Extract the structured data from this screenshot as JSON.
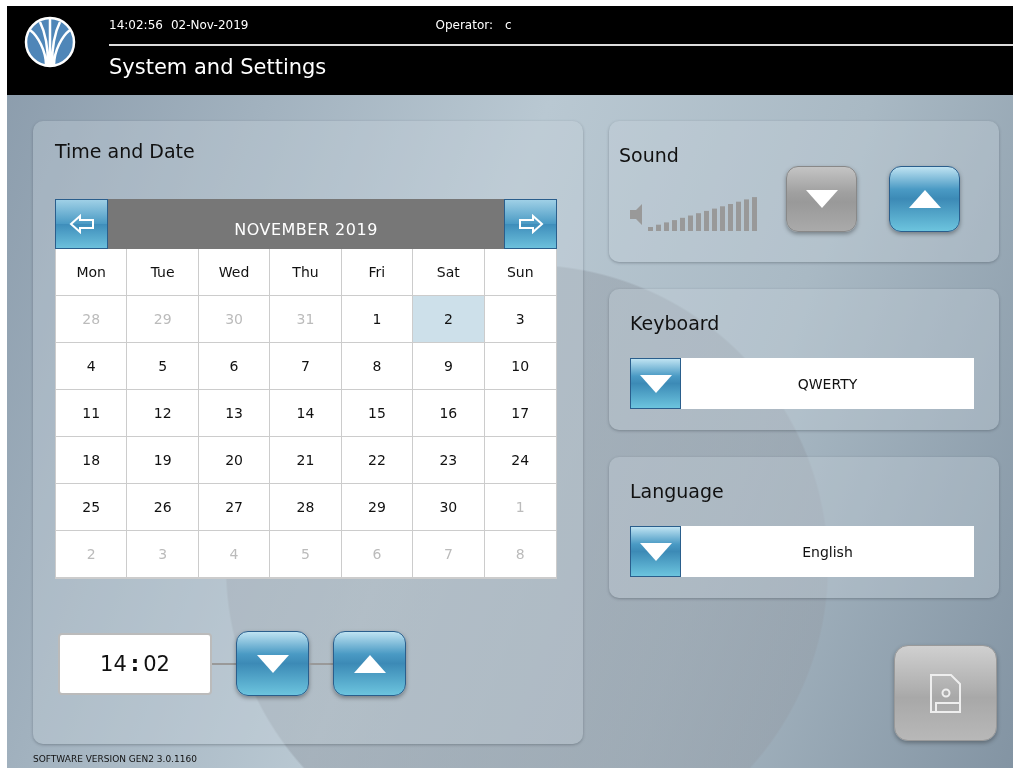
{
  "header": {
    "time": "14:02:56",
    "date": "02-Nov-2019",
    "operator_label": "Operator:",
    "operator": "c",
    "title": "System and Settings"
  },
  "time_and_date": {
    "title": "Time and Date",
    "month": "NOVEMBER 2019",
    "weekdays": [
      "Mon",
      "Tue",
      "Wed",
      "Thu",
      "Fri",
      "Sat",
      "Sun"
    ],
    "weeks": [
      [
        {
          "day": "28",
          "other_month": true,
          "selected": false
        },
        {
          "day": "29",
          "other_month": true,
          "selected": false
        },
        {
          "day": "30",
          "other_month": true,
          "selected": false
        },
        {
          "day": "31",
          "other_month": true,
          "selected": false
        },
        {
          "day": "1",
          "other_month": false,
          "selected": false
        },
        {
          "day": "2",
          "other_month": false,
          "selected": true
        },
        {
          "day": "3",
          "other_month": false,
          "selected": false
        }
      ],
      [
        {
          "day": "4",
          "other_month": false,
          "selected": false
        },
        {
          "day": "5",
          "other_month": false,
          "selected": false
        },
        {
          "day": "6",
          "other_month": false,
          "selected": false
        },
        {
          "day": "7",
          "other_month": false,
          "selected": false
        },
        {
          "day": "8",
          "other_month": false,
          "selected": false
        },
        {
          "day": "9",
          "other_month": false,
          "selected": false
        },
        {
          "day": "10",
          "other_month": false,
          "selected": false
        }
      ],
      [
        {
          "day": "11",
          "other_month": false,
          "selected": false
        },
        {
          "day": "12",
          "other_month": false,
          "selected": false
        },
        {
          "day": "13",
          "other_month": false,
          "selected": false
        },
        {
          "day": "14",
          "other_month": false,
          "selected": false
        },
        {
          "day": "15",
          "other_month": false,
          "selected": false
        },
        {
          "day": "16",
          "other_month": false,
          "selected": false
        },
        {
          "day": "17",
          "other_month": false,
          "selected": false
        }
      ],
      [
        {
          "day": "18",
          "other_month": false,
          "selected": false
        },
        {
          "day": "19",
          "other_month": false,
          "selected": false
        },
        {
          "day": "20",
          "other_month": false,
          "selected": false
        },
        {
          "day": "21",
          "other_month": false,
          "selected": false
        },
        {
          "day": "22",
          "other_month": false,
          "selected": false
        },
        {
          "day": "23",
          "other_month": false,
          "selected": false
        },
        {
          "day": "24",
          "other_month": false,
          "selected": false
        }
      ],
      [
        {
          "day": "25",
          "other_month": false,
          "selected": false
        },
        {
          "day": "26",
          "other_month": false,
          "selected": false
        },
        {
          "day": "27",
          "other_month": false,
          "selected": false
        },
        {
          "day": "28",
          "other_month": false,
          "selected": false
        },
        {
          "day": "29",
          "other_month": false,
          "selected": false
        },
        {
          "day": "30",
          "other_month": false,
          "selected": false
        },
        {
          "day": "1",
          "other_month": true,
          "selected": false
        }
      ],
      [
        {
          "day": "2",
          "other_month": true,
          "selected": false
        },
        {
          "day": "3",
          "other_month": true,
          "selected": false
        },
        {
          "day": "4",
          "other_month": true,
          "selected": false
        },
        {
          "day": "5",
          "other_month": true,
          "selected": false
        },
        {
          "day": "6",
          "other_month": true,
          "selected": false
        },
        {
          "day": "7",
          "other_month": true,
          "selected": false
        },
        {
          "day": "8",
          "other_month": true,
          "selected": false
        }
      ]
    ],
    "time_hours": "14",
    "time_separator": ":",
    "time_minutes": "02"
  },
  "sound": {
    "title": "Sound",
    "down_disabled": true,
    "up_disabled": false
  },
  "keyboard": {
    "title": "Keyboard",
    "value": "QWERTY"
  },
  "language": {
    "title": "Language",
    "value": "English"
  },
  "save_disabled": true,
  "footer": "SOFTWARE VERSION GEN2 3.0.1160"
}
